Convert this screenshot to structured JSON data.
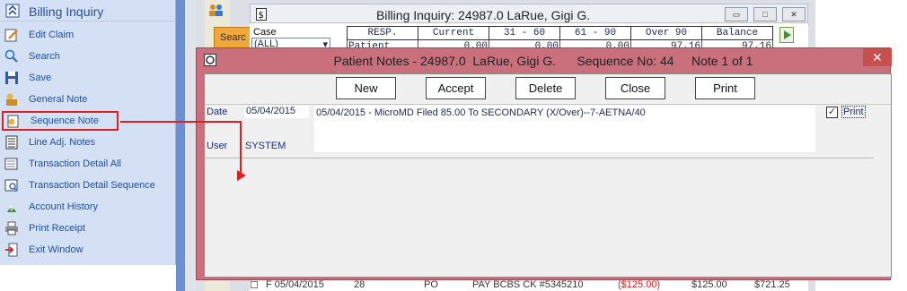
{
  "sidebar": {
    "title": "Billing Inquiry",
    "items": [
      {
        "label": "Edit Claim",
        "icon": "edit-claim-icon"
      },
      {
        "label": "Search",
        "icon": "search-icon"
      },
      {
        "label": "Save",
        "icon": "save-icon"
      },
      {
        "label": "General Note",
        "icon": "general-note-icon"
      },
      {
        "label": "Sequence Note",
        "icon": "sequence-note-icon"
      },
      {
        "label": "Line Adj. Notes",
        "icon": "line-adj-notes-icon"
      },
      {
        "label": "Transaction Detail All",
        "icon": "transaction-detail-all-icon"
      },
      {
        "label": "Transaction Detail Sequence",
        "icon": "transaction-detail-sequence-icon"
      },
      {
        "label": "Account History",
        "icon": "account-history-icon"
      },
      {
        "label": "Print Receipt",
        "icon": "print-receipt-icon"
      },
      {
        "label": "Exit Window",
        "icon": "exit-window-icon"
      }
    ]
  },
  "billing": {
    "title": "Billing Inquiry: 24987.0  LaRue, Gigi G.",
    "search_tab": "Searc",
    "case_label": "Case",
    "case_value": "(ALL)",
    "columns": [
      "RESP.",
      "Current",
      "31 - 60",
      "61 - 90",
      "Over 90",
      "Balance"
    ],
    "first_row": [
      "Patient",
      "0.00",
      "0.00",
      "0.00",
      "97.16",
      "97.16"
    ],
    "bottom_row": {
      "date": "F  05/04/2015",
      "seq": "28",
      "code": "PO",
      "desc": "PAY BCBS CK #5345210",
      "amount": "($125.00)",
      "paid": "$125.00",
      "balance": "$721.25"
    }
  },
  "notes": {
    "title": "Patient Notes - 24987.0  LaRue, Gigi G.      Sequence No: 44     Note 1 of 1",
    "close": "✕",
    "buttons": {
      "new": "New",
      "accept": "Accept",
      "delete": "Delete",
      "close": "Close",
      "print": "Print"
    },
    "date_label": "Date",
    "date_value": "05/04/2015",
    "user_label": "User",
    "user_value": "SYSTEM",
    "note_text": "05/04/2015 - MicroMD Filed 85.00 To  SECONDARY  (X/Over)--7-AETNA/40",
    "print_checked": "✓",
    "print_label": "Print"
  }
}
